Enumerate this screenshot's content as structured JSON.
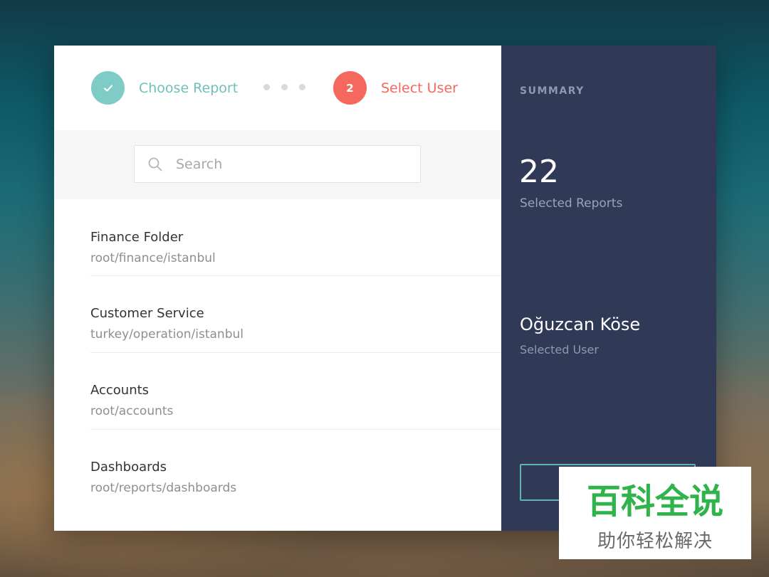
{
  "stepper": {
    "step1": {
      "label": "Choose Report",
      "icon": "check-icon",
      "color": "#7fcbc6"
    },
    "step2": {
      "number": "2",
      "label": "Select User",
      "color": "#f4685e"
    }
  },
  "search": {
    "placeholder": "Search",
    "value": ""
  },
  "list": {
    "items": [
      {
        "title": "Finance Folder",
        "path": "root/finance/istanbul"
      },
      {
        "title": "Customer Service",
        "path": "turkey/operation/istanbul"
      },
      {
        "title": "Accounts",
        "path": "root/accounts"
      },
      {
        "title": "Dashboards",
        "path": "root/reports/dashboards"
      }
    ]
  },
  "summary": {
    "title": "SUMMARY",
    "count": "22",
    "count_label": "Selected Reports",
    "user_name": "Oğuzcan Köse",
    "user_label": "Selected User",
    "panel_color": "#303a57",
    "button_border_color": "#5fb5ae"
  },
  "watermark": {
    "main": "百科全说",
    "sub": "助你轻松解决",
    "color": "#2fb34a"
  }
}
